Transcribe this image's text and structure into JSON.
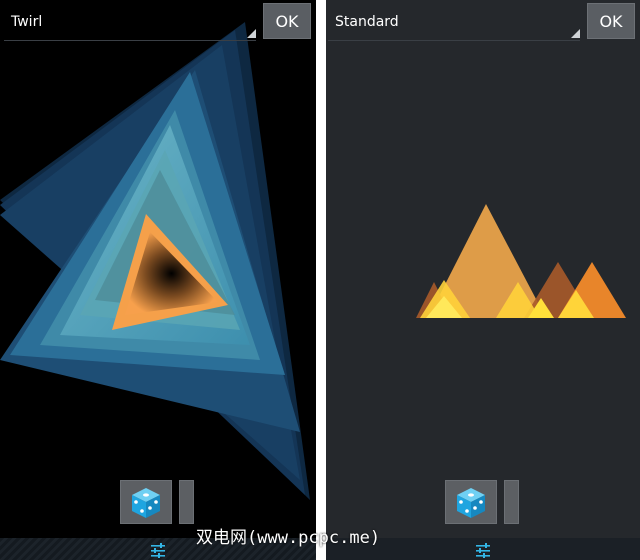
{
  "left_panel": {
    "style_select": {
      "value": "Twirl"
    },
    "ok_button": {
      "label": "OK"
    },
    "random_button": {
      "icon": "dice-icon"
    },
    "settings": {
      "icon": "sliders-icon"
    }
  },
  "right_panel": {
    "style_select": {
      "value": "Standard"
    },
    "ok_button": {
      "label": "OK"
    },
    "random_button": {
      "icon": "dice-icon"
    },
    "settings": {
      "icon": "sliders-icon"
    }
  },
  "watermark": {
    "text": "双电网(www.pcpc.me)"
  },
  "colors": {
    "left_background": "#000000",
    "right_background": "#25282c",
    "accent_blue": "#33b5e5",
    "dice_blue": "#1fa5e0",
    "triangle_orange": "#f5a04a",
    "triangle_blue": "#3a7fa8",
    "mountain_orange": "#e8a24a",
    "mountain_yellow": "#ffe03a"
  }
}
